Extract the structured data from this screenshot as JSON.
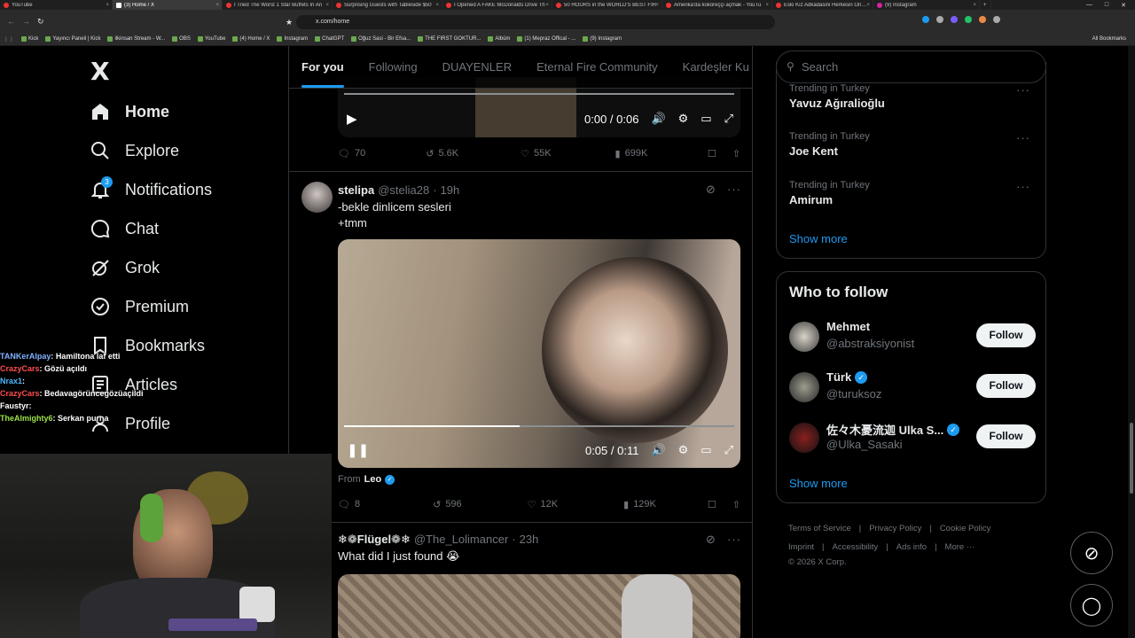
{
  "browser": {
    "tabs": [
      {
        "title": "YouTube",
        "icon": "youtube-favicon"
      },
      {
        "title": "(3) Home / X",
        "icon": "x-favicon",
        "active": true
      },
      {
        "title": "I Tried The Worst 1 Star Buffets In An",
        "icon": "youtube-favicon"
      },
      {
        "title": "Surprising Guests with Tableside $50",
        "icon": "youtube-favicon"
      },
      {
        "title": "I Opened A FAKE McDonalds Drive Th",
        "icon": "youtube-favicon"
      },
      {
        "title": "50 HOURS in the WORLD'S BEST FIR",
        "icon": "youtube-favicon"
      },
      {
        "title": "Amerika'da kokoreççi açmak - YouTu",
        "icon": "youtube-favicon"
      },
      {
        "title": "Eski Kız Adkadasini Herkesin Öndün",
        "icon": "youtube-favicon"
      },
      {
        "title": "(9) Instagram",
        "icon": "instagram-favicon"
      }
    ],
    "new_tab": "+",
    "url": "x.com/home",
    "bookmarks": [
      "Kick",
      "Yayıncı Paneli | Kick",
      "ilkinsan Stream - W...",
      "OBS",
      "YouTube",
      "(4) Home / X",
      "Instagram",
      "ChatGPT",
      "Oğuz Sasi - Bir Efsa...",
      "THE FIRST GOKTUR...",
      "Albüm",
      "(1) Mepraz Offical - ...",
      "(9) Instagram"
    ],
    "all_bookmarks": "All Bookmarks"
  },
  "nav": {
    "logo": "X",
    "items": [
      {
        "label": "Home",
        "icon": "home-icon"
      },
      {
        "label": "Explore",
        "icon": "search-icon"
      },
      {
        "label": "Notifications",
        "icon": "bell-icon"
      },
      {
        "label": "Chat",
        "icon": "chat-icon"
      },
      {
        "label": "Grok",
        "icon": "grok-icon"
      },
      {
        "label": "Premium",
        "icon": "premium-icon"
      },
      {
        "label": "Bookmarks",
        "icon": "bookmark-icon"
      },
      {
        "label": "Articles",
        "icon": "articles-icon"
      },
      {
        "label": "Profile",
        "icon": "profile-icon"
      }
    ],
    "notification_count": "3"
  },
  "feed": {
    "tabs": [
      "For you",
      "Following",
      "DUAYENLER",
      "Eternal Fire Community",
      "Kardeşler Ku"
    ],
    "post1": {
      "video_time": "0:00 / 0:06",
      "replies": "70",
      "reposts": "5.6K",
      "likes": "55K",
      "views": "699K"
    },
    "post2": {
      "name": "stelipa",
      "handle": "@stelia28",
      "time": "19h",
      "text_line1": "-bekle dinlicem sesleri",
      "text_line2": "+tmm",
      "video_time": "0:05 / 0:11",
      "video_progress": 0.45,
      "from_label": "From",
      "from_name": "Leo",
      "replies": "8",
      "reposts": "596",
      "likes": "12K",
      "views": "129K"
    },
    "post3": {
      "name": "❄❁Flügel❁❄",
      "handle": "@The_Lolimancer",
      "time": "23h",
      "text": "What did I just found 😭"
    }
  },
  "right": {
    "search_placeholder": "Search",
    "trends": [
      {
        "category": "Trending in Turkey",
        "name": "Yavuz Ağıralioğlu"
      },
      {
        "category": "Trending in Turkey",
        "name": "Joe Kent"
      },
      {
        "category": "Trending in Turkey",
        "name": "Amirum"
      }
    ],
    "show_more": "Show more",
    "who_to_follow_title": "Who to follow",
    "who_to_follow": [
      {
        "name": "Mehmet",
        "handle": "@abstraksiyonist",
        "verified": false
      },
      {
        "name": "Türk",
        "handle": "@turuksoz",
        "verified": true
      },
      {
        "name": "佐々木憂流迦 Ulka S...",
        "handle": "@Ulka_Sasaki",
        "verified": true
      }
    ],
    "follow_label": "Follow",
    "footer": [
      "Terms of Service",
      "Privacy Policy",
      "Cookie Policy",
      "Imprint",
      "Accessibility",
      "Ads info",
      "More ···"
    ],
    "copyright": "© 2026 X Corp."
  },
  "stream_chat": [
    {
      "user": "TANKerAlpay",
      "msg": "Hamiltona laf etti",
      "color": "#7fb2ff"
    },
    {
      "user": "CrazyCars",
      "msg": "Gözü açıldı",
      "color": "#ff4d4d"
    },
    {
      "user": "Nrax1",
      "msg": "",
      "color": "#4db8ff"
    },
    {
      "user": "CrazyCars",
      "msg": "Bedavagörüncegözüaçildi",
      "color": "#ff4d4d"
    },
    {
      "user": "Faustyr",
      "msg": "",
      "color": "#ffffff"
    },
    {
      "user": "TheAlmighty6",
      "msg": "Serkan purna",
      "color": "#9be34a"
    }
  ],
  "colors": {
    "accent": "#1d9bf0",
    "bg": "#000000",
    "border": "#2f3336",
    "muted": "#71767b"
  }
}
